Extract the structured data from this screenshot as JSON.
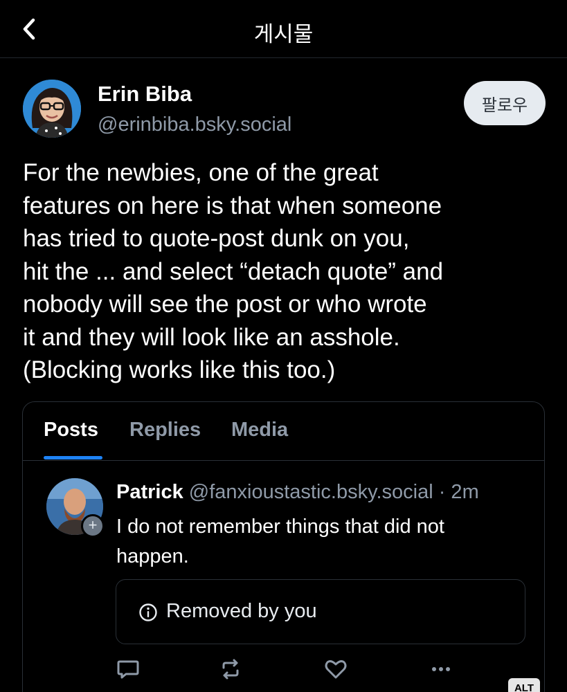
{
  "header": {
    "title": "게시물"
  },
  "author": {
    "name": "Erin Biba",
    "handle": "@erinbiba.bsky.social",
    "follow_label": "팔로우"
  },
  "post": {
    "text": "For the newbies, one of the great\nfeatures on here is that when someone\nhas tried to quote-post dunk on you,\nhit the ... and select “detach quote” and\nnobody will see the post or who wrote\nit and they will look like an asshole.\n(Blocking works like this too.)"
  },
  "embed": {
    "tabs": [
      {
        "label": "Posts",
        "active": true
      },
      {
        "label": "Replies",
        "active": false
      },
      {
        "label": "Media",
        "active": false
      }
    ],
    "reply": {
      "name": "Patrick",
      "handle_time": " @fanxioustastic.bsky.social · 2m",
      "text": "I do not remember things that did not happen.",
      "removed_text": "Removed by you"
    },
    "alt_badge": "ALT"
  },
  "colors": {
    "background": "#000000",
    "muted_text": "#8f9aa8",
    "accent": "#1e83f7",
    "follow_bg": "#e6ebf0"
  },
  "icons": [
    "back-chevron-icon",
    "info-icon",
    "reply-icon",
    "repost-icon",
    "like-icon",
    "more-icon",
    "plus-icon"
  ]
}
